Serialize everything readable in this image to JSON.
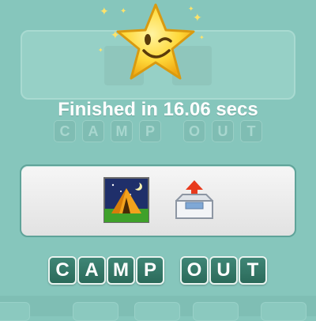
{
  "result": {
    "message": "Finished in 16.06 secs"
  },
  "answer": {
    "tiles": [
      "C",
      "A",
      "M",
      "P",
      "O",
      "U",
      "T"
    ]
  },
  "background_answer": {
    "tiles": [
      "C",
      "A",
      "M",
      "P",
      "O",
      "U",
      "T"
    ]
  },
  "clues": [
    {
      "icon": "camping-tent-icon"
    },
    {
      "icon": "outbox-tray-icon"
    }
  ],
  "colors": {
    "background": "#86c6bc",
    "tile": "#2f6f5f",
    "star": "#ffd23e"
  }
}
